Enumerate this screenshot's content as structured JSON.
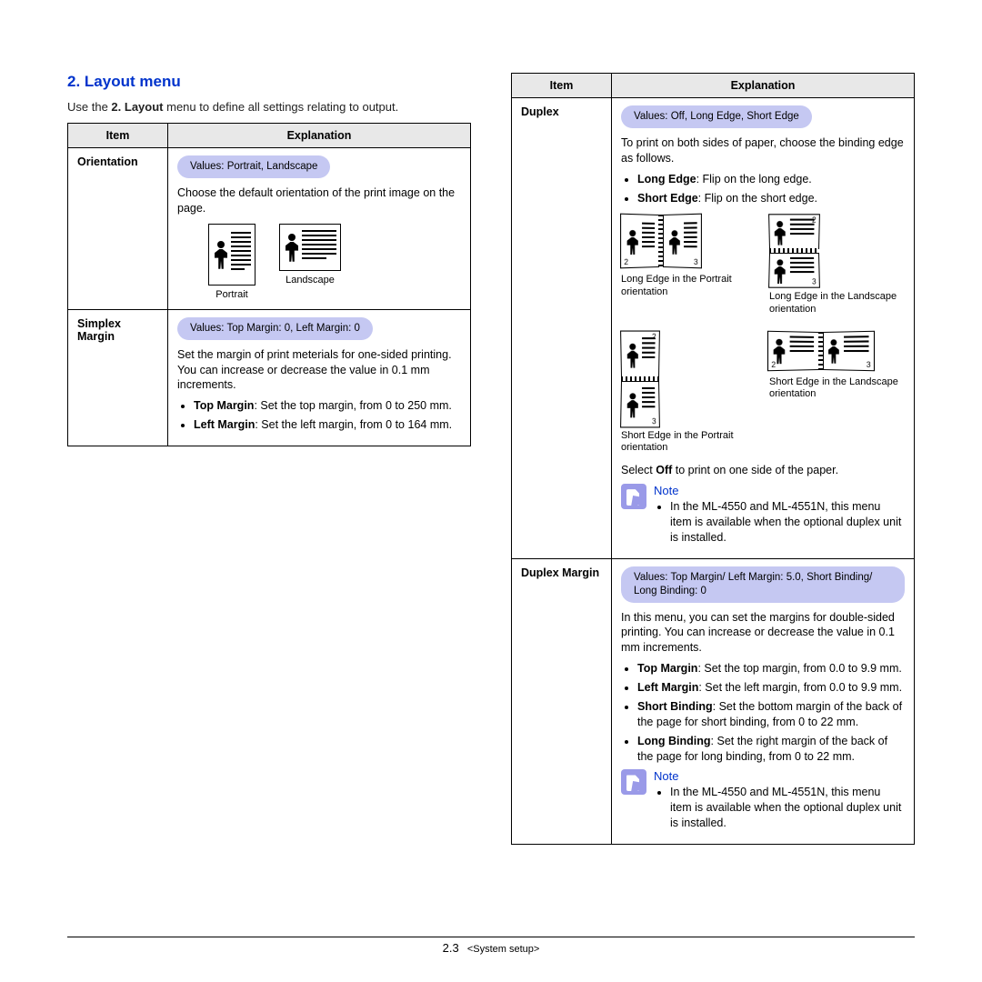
{
  "section": {
    "number": "2.",
    "title": "Layout menu",
    "intro_prefix": "Use the ",
    "intro_bold": "2. Layout",
    "intro_suffix": " menu to define all settings relating to output."
  },
  "headers": {
    "item": "Item",
    "explanation": "Explanation"
  },
  "leftTable": {
    "row1": {
      "item": "Orientation",
      "values": "Values: Portrait, Landscape",
      "desc": "Choose the default orientation of the print image on the page.",
      "portrait": "Portrait",
      "landscape": "Landscape"
    },
    "row2": {
      "item": "Simplex Margin",
      "values": "Values: Top Margin: 0, Left Margin: 0",
      "desc": "Set the margin of print meterials for one-sided printing. You can increase or decrease the value in 0.1 mm increments.",
      "b1_bold": "Top Margin",
      "b1_rest": ": Set the top margin, from 0 to 250 mm.",
      "b2_bold": "Left Margin",
      "b2_rest": ": Set the left margin, from 0 to 164 mm."
    }
  },
  "rightTable": {
    "row1": {
      "item": "Duplex",
      "values": "Values: Off, Long Edge, Short Edge",
      "desc": "To print on both sides of paper, choose the binding edge as follows.",
      "b1_bold": "Long Edge",
      "b1_rest": ": Flip on the long edge.",
      "b2_bold": "Short Edge",
      "b2_rest": ": Flip on the short edge.",
      "cap1": "Long Edge in the Portrait orientation",
      "cap2": "Long Edge in the Landscape orientation",
      "cap3": "Short Edge in the Portrait orientation",
      "cap4": "Short Edge in the Landscape orientation",
      "select_prefix": "Select ",
      "select_bold": "Off",
      "select_suffix": " to print on one side of the paper.",
      "note_label": "Note",
      "note": "In the ML-4550 and ML-4551N, this menu item is available when the optional duplex unit is installed."
    },
    "row2": {
      "item": "Duplex Margin",
      "values": "Values: Top Margin/ Left Margin: 5.0, Short Binding/ Long Binding: 0",
      "desc": "In this menu, you can set the margins for double-sided printing. You can increase or decrease the value in 0.1 mm increments.",
      "b1_bold": "Top Margin",
      "b1_rest": ": Set the top margin, from 0.0 to 9.9 mm.",
      "b2_bold": "Left Margin",
      "b2_rest": ": Set the left margin, from 0.0 to 9.9 mm.",
      "b3_bold": "Short Binding",
      "b3_rest": ": Set the bottom margin of the back of the page for short binding, from 0 to 22 mm.",
      "b4_bold": "Long Binding",
      "b4_rest": ": Set the right margin of the back of the page for long binding, from 0 to 22 mm.",
      "note_label": "Note",
      "note": "In the ML-4550 and ML-4551N, this menu item is available when the optional duplex unit is installed."
    }
  },
  "footer": {
    "page": "2.3",
    "chapter": "<System setup>"
  }
}
